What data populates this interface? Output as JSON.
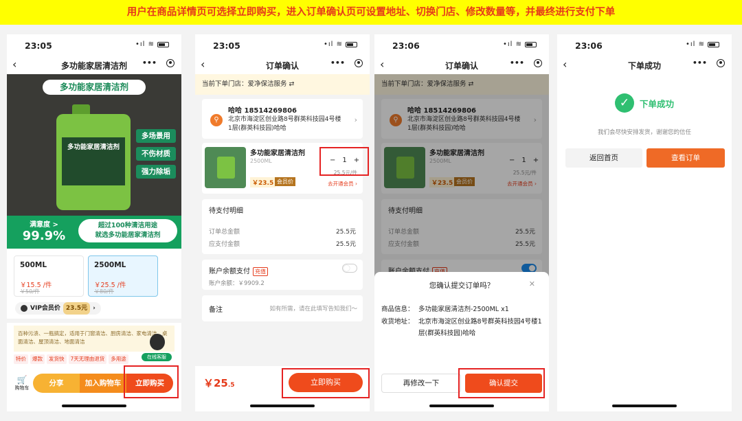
{
  "banner": "用户在商品详情页可选择立即购买，进入订单确认页可设置地址、切换门店、修改数量等，并最终进行支付下单",
  "phones": [
    {
      "time": "23:05",
      "title": "多功能家居清洁剂"
    },
    {
      "time": "23:05",
      "title": "订单确认"
    },
    {
      "time": "23:06",
      "title": "订单确认"
    },
    {
      "time": "23:06",
      "title": "下单成功"
    }
  ],
  "status_icons": "•ıl  ≋",
  "nav": {
    "back": "‹",
    "more": "•••"
  },
  "product": {
    "hero_title": "多功能家居清洁剂",
    "jug_label": "多功能家居清洁剂",
    "tags": [
      "多场景用",
      "不伤材质",
      "强力除垢"
    ],
    "satisfaction_label": "满意度 >",
    "satisfaction_value": "99.9%",
    "slogan_line1": "超过100种清洁用途",
    "slogan_line2": "就选多功能居家清洁剂",
    "specs": [
      {
        "name": "500ML",
        "price": "￥15.5 /件",
        "old": "￥50/件"
      },
      {
        "name": "2500ML",
        "price": "￥25.5 /件",
        "old": "￥80/件"
      }
    ],
    "vip_label": "VIP会员价",
    "vip_price": "23.5元",
    "vip_chevron": "›",
    "description": "百种污渍、一瓶搞定，适用于门窗清洁、厨房清洁、家电清洁、桌面清洁、屋顶清洁、地面清洁",
    "chips": [
      "特价",
      "爆款",
      "发货快",
      "7天无理由退货",
      "多用途"
    ],
    "kefu": "在线客服",
    "cart_icon": "🛒",
    "cart": "购物车",
    "share": "分享",
    "add_cart": "加入购物车",
    "buy_now": "立即购买"
  },
  "order": {
    "store": "当前下单门店：爱净保洁服务 ⇄",
    "addr_pin": "⚲",
    "name": "哈哈   18514269806",
    "address": "北京市海淀区创业路8号群英科技园4号楼1层(群英科技园)哈哈",
    "chevron": "›",
    "product_name": "多功能家居清洁剂",
    "product_spec": "2500ML",
    "stepper_minus": "−",
    "qty": "1",
    "stepper_plus": "+",
    "unit_price": "25.5元/件",
    "member_price": "￥23.5",
    "member_badge": "会员价",
    "join_member": "去开通会员 ›",
    "pay_detail": "待支付明细",
    "order_total_label": "订单总金额",
    "order_total": "25.5元",
    "payable_label": "应支付金额",
    "payable": "25.5元",
    "balance_pay": "账户余额支付",
    "recharge": "充值",
    "balance": "账户余额：￥9909.2",
    "remark_label": "备注",
    "remark_placeholder": "如有所需，请在此填写告知我们～",
    "total_main": "￥25",
    "total_small": ".5",
    "buy_now": "立即购买"
  },
  "confirm": {
    "title": "您确认提交订单吗？",
    "close": "✕",
    "goods_label": "商品信息：",
    "goods": "多功能家居清洁剂-2500ML x1",
    "addr_label": "收货地址：",
    "addr": "北京市海淀区创业路8号群英科技园4号楼1层(群英科技园)哈哈",
    "modify": "再修改一下",
    "submit": "确认提交"
  },
  "success": {
    "check": "✓",
    "title": "下单成功",
    "subtitle": "我们会尽快安排发货，谢谢您的信任",
    "home": "返回首页",
    "view_order": "查看订单"
  }
}
